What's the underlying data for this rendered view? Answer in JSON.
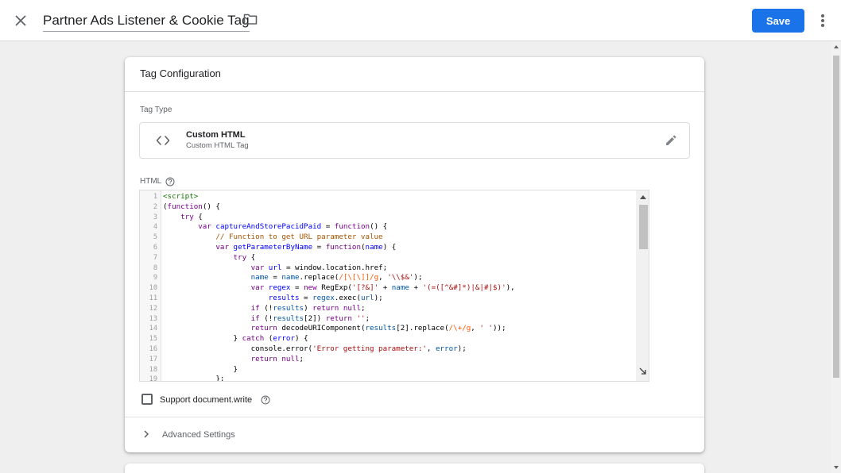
{
  "header": {
    "title": "Partner Ads Listener & Cookie Tag",
    "save_label": "Save",
    "close_icon": "close-icon",
    "folder_icon": "folder-icon",
    "more_icon": "more-vert-icon"
  },
  "card": {
    "title": "Tag Configuration",
    "tag_type_label": "Tag Type",
    "tag_type": {
      "name": "Custom HTML",
      "subtitle": "Custom HTML Tag",
      "icon": "code-brackets-icon"
    },
    "html_label": "HTML",
    "support_doc_write_label": "Support document.write",
    "support_doc_write_checked": false,
    "advanced_settings_label": "Advanced Settings"
  },
  "code_lines": [
    {
      "n": "1",
      "segs": [
        [
          "tag",
          "<script>"
        ]
      ]
    },
    {
      "n": "2",
      "segs": [
        [
          "pl",
          "("
        ],
        [
          "kw",
          "function"
        ],
        [
          "pl",
          "() {"
        ]
      ]
    },
    {
      "n": "3",
      "segs": [
        [
          "pl",
          "    "
        ],
        [
          "kw",
          "try"
        ],
        [
          "pl",
          " {"
        ]
      ]
    },
    {
      "n": "4",
      "segs": [
        [
          "pl",
          "        "
        ],
        [
          "kw",
          "var"
        ],
        [
          "pl",
          " "
        ],
        [
          "def",
          "captureAndStorePacidPaid"
        ],
        [
          "pl",
          " = "
        ],
        [
          "kw",
          "function"
        ],
        [
          "pl",
          "() {"
        ]
      ]
    },
    {
      "n": "5",
      "segs": [
        [
          "pl",
          "            "
        ],
        [
          "cm",
          "// Function to get URL parameter value"
        ]
      ]
    },
    {
      "n": "6",
      "segs": [
        [
          "pl",
          "            "
        ],
        [
          "kw",
          "var"
        ],
        [
          "pl",
          " "
        ],
        [
          "def",
          "getParameterByName"
        ],
        [
          "pl",
          " = "
        ],
        [
          "kw",
          "function"
        ],
        [
          "pl",
          "("
        ],
        [
          "def",
          "name"
        ],
        [
          "pl",
          ") {"
        ]
      ]
    },
    {
      "n": "7",
      "segs": [
        [
          "pl",
          "                "
        ],
        [
          "kw",
          "try"
        ],
        [
          "pl",
          " {"
        ]
      ]
    },
    {
      "n": "8",
      "segs": [
        [
          "pl",
          "                    "
        ],
        [
          "kw",
          "var"
        ],
        [
          "pl",
          " "
        ],
        [
          "def",
          "url"
        ],
        [
          "pl",
          " = window.location.href;"
        ]
      ]
    },
    {
      "n": "9",
      "segs": [
        [
          "pl",
          "                    "
        ],
        [
          "var",
          "name"
        ],
        [
          "pl",
          " = "
        ],
        [
          "var",
          "name"
        ],
        [
          "pl",
          ".replace("
        ],
        [
          "re",
          "/[\\[\\]]/g"
        ],
        [
          "pl",
          ", "
        ],
        [
          "str",
          "'\\\\$&'"
        ],
        [
          "pl",
          ");"
        ]
      ]
    },
    {
      "n": "10",
      "segs": [
        [
          "pl",
          "                    "
        ],
        [
          "kw",
          "var"
        ],
        [
          "pl",
          " "
        ],
        [
          "def",
          "regex"
        ],
        [
          "pl",
          " = "
        ],
        [
          "kw",
          "new"
        ],
        [
          "pl",
          " RegExp("
        ],
        [
          "str",
          "'[?&]'"
        ],
        [
          "pl",
          " + "
        ],
        [
          "var",
          "name"
        ],
        [
          "pl",
          " + "
        ],
        [
          "str",
          "'(=([^&#]*)|&|#|$)'"
        ],
        [
          "pl",
          "),"
        ]
      ]
    },
    {
      "n": "11",
      "segs": [
        [
          "pl",
          "                        "
        ],
        [
          "def",
          "results"
        ],
        [
          "pl",
          " = "
        ],
        [
          "var",
          "regex"
        ],
        [
          "pl",
          ".exec("
        ],
        [
          "var",
          "url"
        ],
        [
          "pl",
          ");"
        ]
      ]
    },
    {
      "n": "12",
      "segs": [
        [
          "pl",
          "                    "
        ],
        [
          "kw",
          "if"
        ],
        [
          "pl",
          " (!"
        ],
        [
          "var",
          "results"
        ],
        [
          "pl",
          ") "
        ],
        [
          "kw",
          "return"
        ],
        [
          "pl",
          " "
        ],
        [
          "kw",
          "null"
        ],
        [
          "pl",
          ";"
        ]
      ]
    },
    {
      "n": "13",
      "segs": [
        [
          "pl",
          "                    "
        ],
        [
          "kw",
          "if"
        ],
        [
          "pl",
          " (!"
        ],
        [
          "var",
          "results"
        ],
        [
          "pl",
          "[2]) "
        ],
        [
          "kw",
          "return"
        ],
        [
          "pl",
          " "
        ],
        [
          "str",
          "''"
        ],
        [
          "pl",
          ";"
        ]
      ]
    },
    {
      "n": "14",
      "segs": [
        [
          "pl",
          "                    "
        ],
        [
          "kw",
          "return"
        ],
        [
          "pl",
          " decodeURIComponent("
        ],
        [
          "var",
          "results"
        ],
        [
          "pl",
          "[2].replace("
        ],
        [
          "re",
          "/\\+/g"
        ],
        [
          "pl",
          ", "
        ],
        [
          "str",
          "' '"
        ],
        [
          "pl",
          "));"
        ]
      ]
    },
    {
      "n": "15",
      "segs": [
        [
          "pl",
          "                } "
        ],
        [
          "kw",
          "catch"
        ],
        [
          "pl",
          " ("
        ],
        [
          "def",
          "error"
        ],
        [
          "pl",
          ") {"
        ]
      ]
    },
    {
      "n": "16",
      "segs": [
        [
          "pl",
          "                    console.error("
        ],
        [
          "str",
          "'Error getting parameter:'"
        ],
        [
          "pl",
          ", "
        ],
        [
          "var",
          "error"
        ],
        [
          "pl",
          ");"
        ]
      ]
    },
    {
      "n": "17",
      "segs": [
        [
          "pl",
          "                    "
        ],
        [
          "kw",
          "return"
        ],
        [
          "pl",
          " "
        ],
        [
          "kw",
          "null"
        ],
        [
          "pl",
          ";"
        ]
      ]
    },
    {
      "n": "18",
      "segs": [
        [
          "pl",
          "                }"
        ]
      ]
    },
    {
      "n": "19",
      "segs": [
        [
          "pl",
          "            };"
        ]
      ]
    }
  ],
  "colors": {
    "accent": "#1a73e8",
    "background": "#efefef"
  }
}
